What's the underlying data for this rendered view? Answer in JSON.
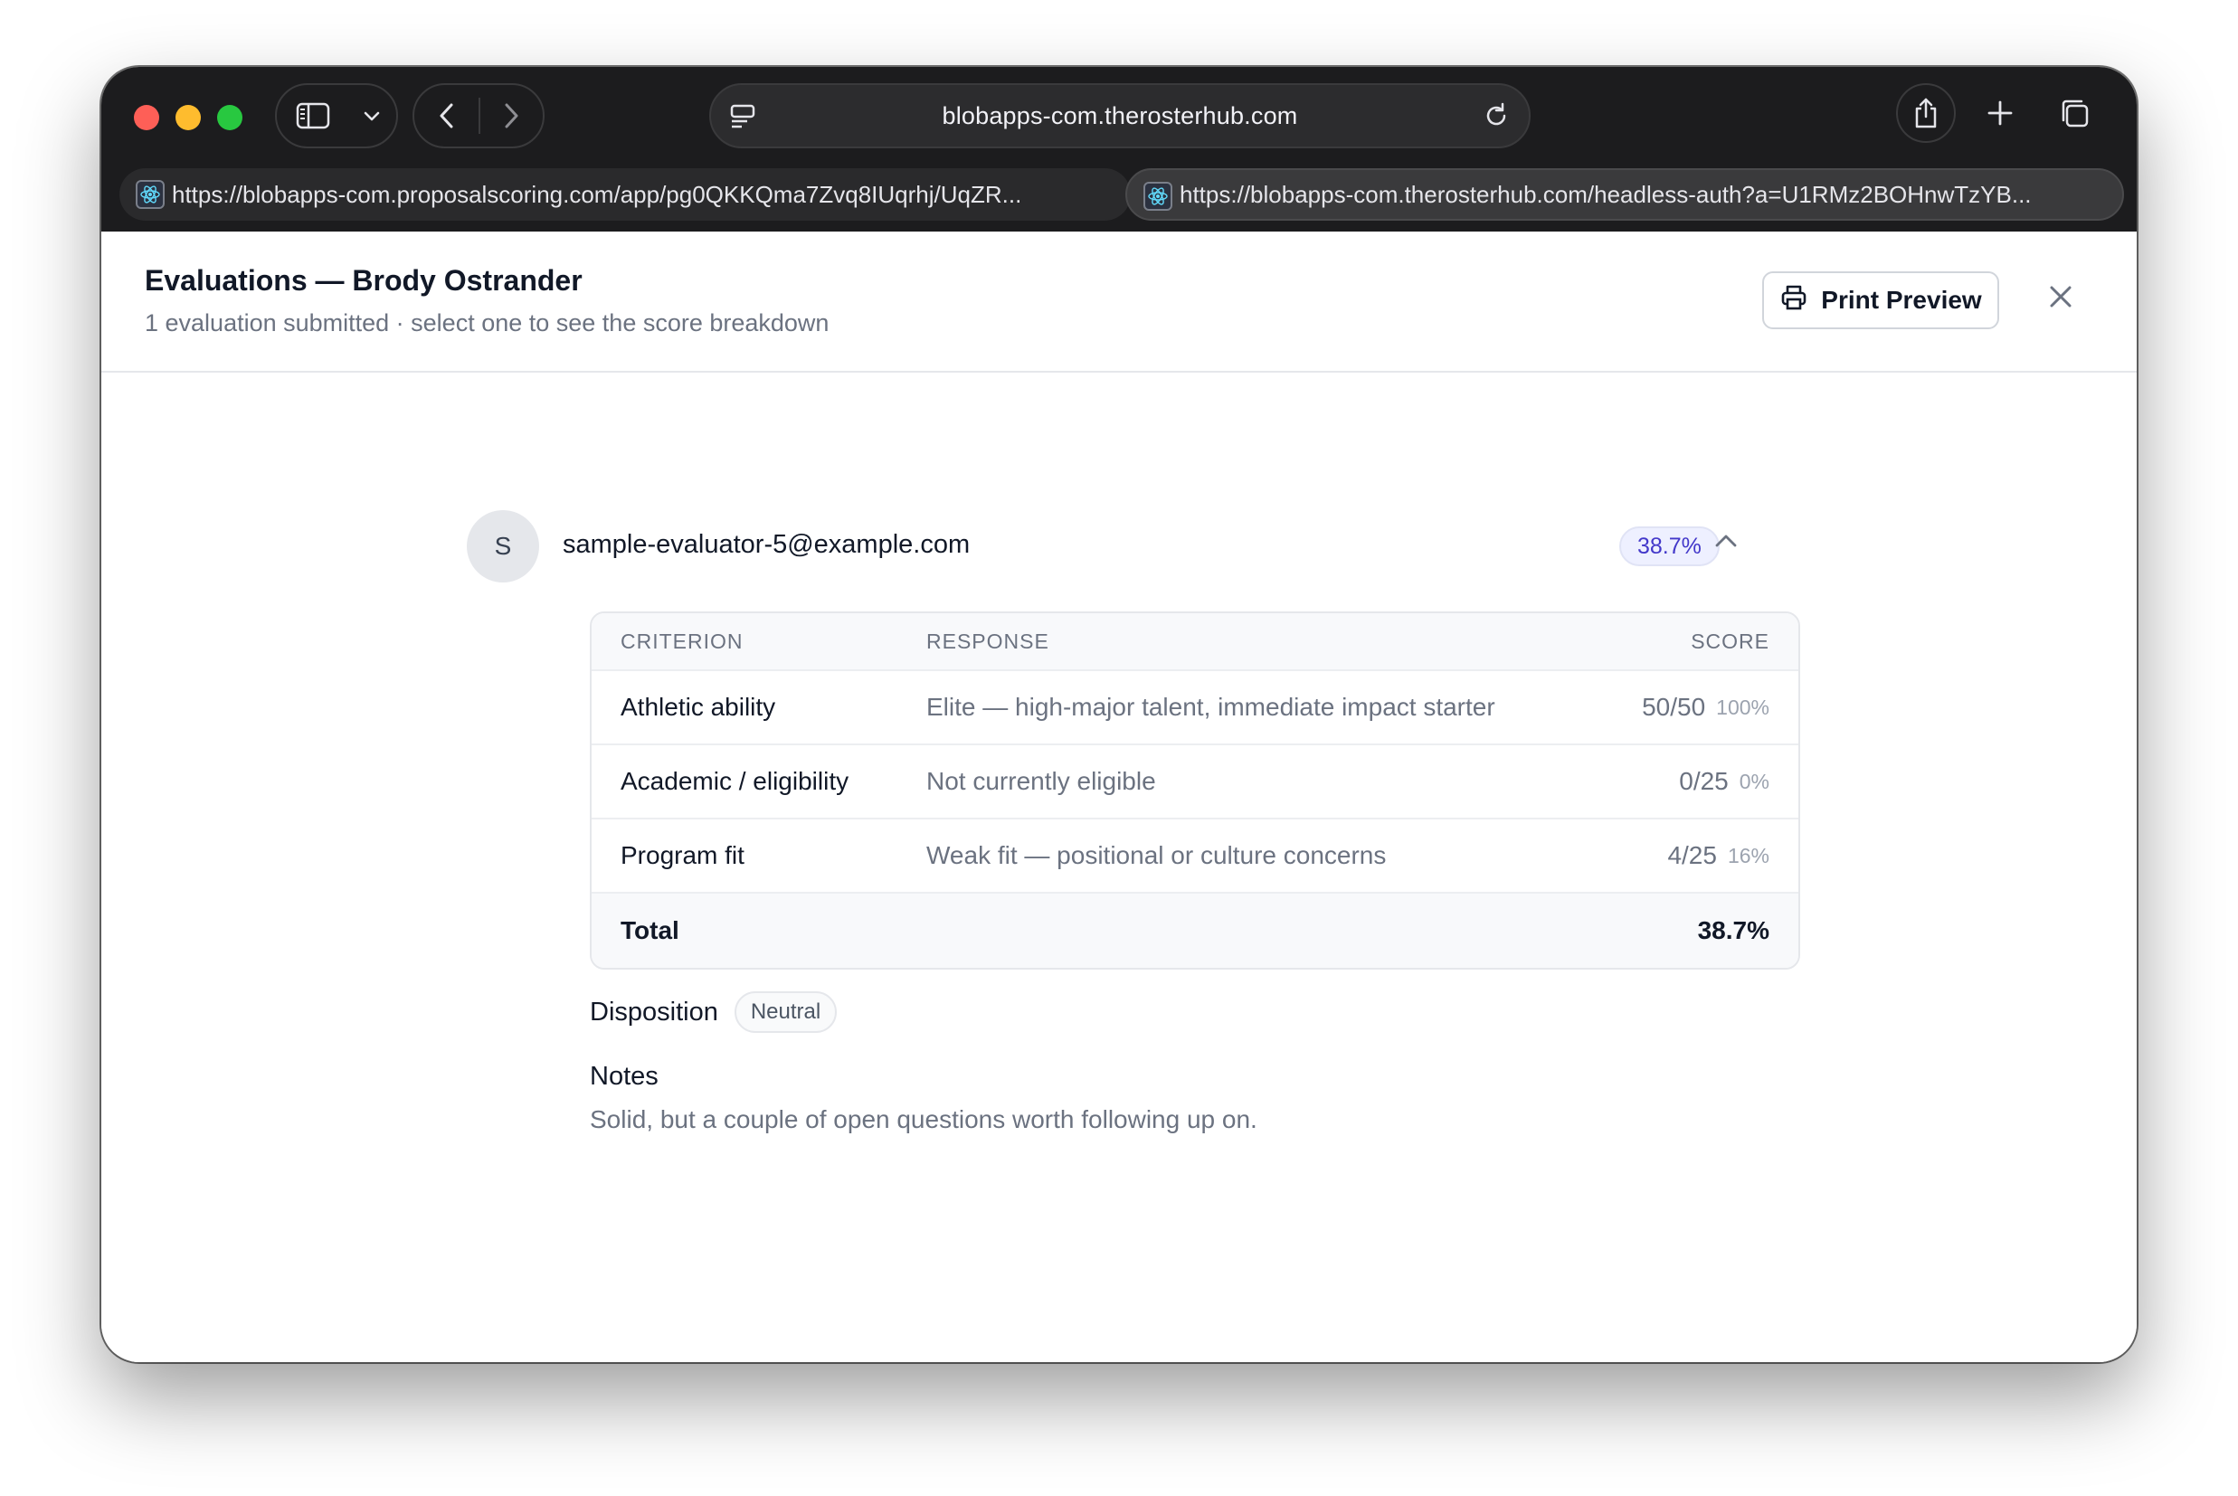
{
  "browser": {
    "address": "blobapps-com.therosterhub.com",
    "tabs": [
      {
        "url": "https://blobapps-com.proposalscoring.com/app/pg0QKKQma7Zvq8IUqrhj/UqZR...",
        "active": false
      },
      {
        "url": "https://blobapps-com.therosterhub.com/headless-auth?a=U1RMz2BOHnwTzYB...",
        "active": true
      }
    ],
    "icons": [
      "sidebar-icon",
      "chevron-down-icon",
      "back-icon",
      "forward-icon",
      "reader-icon",
      "reload-icon",
      "share-icon",
      "plus-icon",
      "tabs-overview-icon",
      "react-favicon"
    ]
  },
  "header": {
    "title": "Evaluations — Brody Ostrander",
    "subtitle": "1 evaluation submitted · select one to see the score breakdown",
    "print_label": "Print Preview"
  },
  "evaluation": {
    "avatar_initial": "S",
    "evaluator": "sample-evaluator-5@example.com",
    "score_badge": "38.7%",
    "accent_color": "#4338ca",
    "table": {
      "columns": [
        "CRITERION",
        "RESPONSE",
        "SCORE"
      ],
      "rows": [
        {
          "criterion": "Athletic ability",
          "response": "Elite — high-major talent, immediate impact starter",
          "score": "50/50",
          "pct": "100%"
        },
        {
          "criterion": "Academic / eligibility",
          "response": "Not currently eligible",
          "score": "0/25",
          "pct": "0%"
        },
        {
          "criterion": "Program fit",
          "response": "Weak fit — positional or culture concerns",
          "score": "4/25",
          "pct": "16%"
        }
      ],
      "total_label": "Total",
      "total_value": "38.7%"
    },
    "disposition_label": "Disposition",
    "disposition_value": "Neutral",
    "notes_label": "Notes",
    "notes_text": "Solid, but a couple of open questions worth following up on."
  }
}
